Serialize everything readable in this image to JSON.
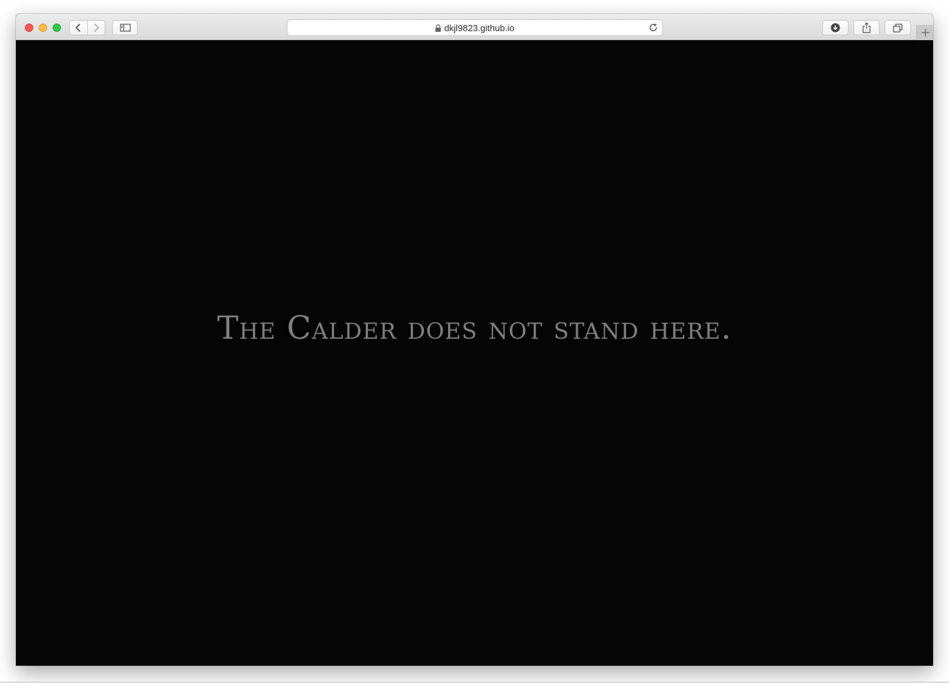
{
  "browser": {
    "address": "dkjl9823.github.io"
  },
  "page": {
    "message": "The Calder does not stand here."
  },
  "colors": {
    "content_background": "#050505",
    "message_text": "#7f7f7f",
    "close": "#fc5753",
    "minimize": "#fdbc40",
    "maximize": "#33c748"
  },
  "icons": {
    "back": "chevron-left-icon",
    "forward": "chevron-right-icon",
    "sidebar": "sidebar-icon",
    "lock": "lock-icon",
    "reload": "reload-icon",
    "downloads": "download-icon",
    "share": "share-icon",
    "tabs": "tabs-icon",
    "new_tab": "plus-icon"
  }
}
